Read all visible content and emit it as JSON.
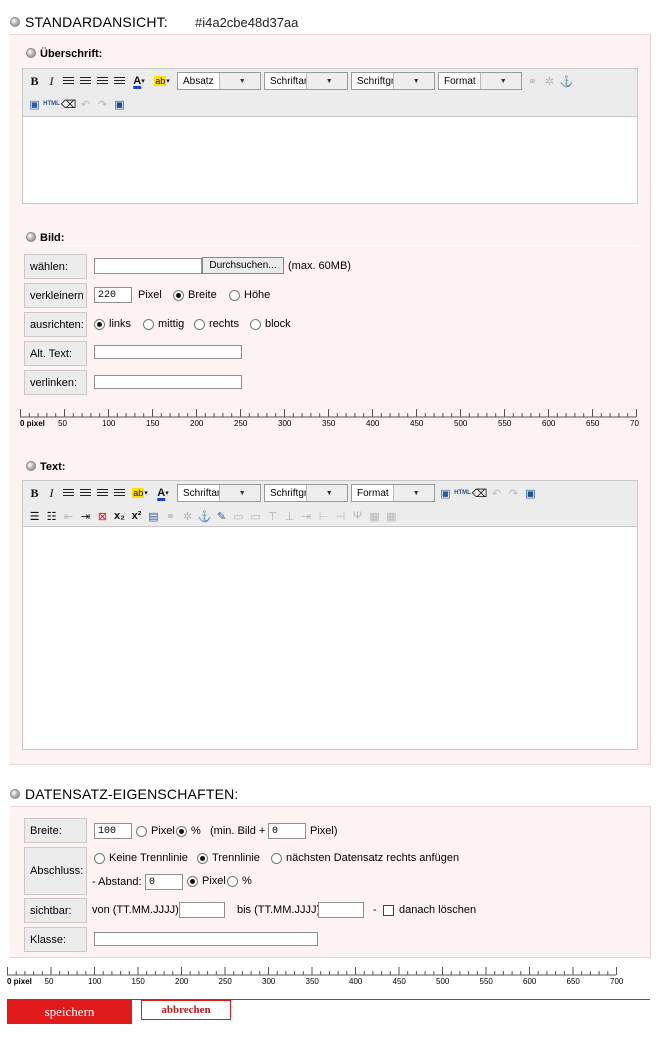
{
  "std": {
    "title": "STANDARDANSICHT:",
    "id": "#i4a2cbe48d37aa"
  },
  "heading": {
    "title": "Überschrift:"
  },
  "toolbar1": {
    "block": "Absatz",
    "font": "Schriftart",
    "size": "Schriftgröße",
    "format": "Format"
  },
  "image": {
    "title": "Bild:",
    "choose_label": "wählen:",
    "browse": "Durchsuchen...",
    "maxsize": "(max. 60MB)",
    "shrink_label": "verkleinern",
    "shrink_value": "220",
    "pixel": "Pixel",
    "width": "Breite",
    "height": "Höhe",
    "align_label": "ausrichten:",
    "left": "links",
    "center": "mittig",
    "right": "rechts",
    "block": "block",
    "alt_label": "Alt. Text:",
    "link_label": "verlinken:"
  },
  "ruler1": {
    "labels": [
      "0 pixel",
      "50",
      "100",
      "150",
      "200",
      "250",
      "300",
      "350",
      "400",
      "450",
      "500",
      "550",
      "600",
      "650",
      "70"
    ]
  },
  "text": {
    "title": "Text:"
  },
  "toolbar2": {
    "font": "Schriftart",
    "size": "Schriftgröße",
    "format": "Format"
  },
  "record": {
    "title": "DATENSATZ-EIGENSCHAFTEN:",
    "width_label": "Breite:",
    "width_value": "100",
    "pixel": "Pixel",
    "percent": "%",
    "min_text": "(min. Bild +",
    "min_value": "0",
    "min_unit": "Pixel)",
    "end_label": "Abschluss:",
    "no_line": "Keine Trennlinie",
    "line": "Trennlinie",
    "next_right": "nächsten Datensatz rechts anfügen",
    "spacing_label": "- Abstand:",
    "spacing_value": "0",
    "spacing_pixel": "Pixel",
    "spacing_percent": "%",
    "visible_label": "sichtbar:",
    "from": "von (TT.MM.JJJJ):",
    "to": "bis (TT.MM.JJJJ)",
    "dash": "-",
    "delete_after": "danach löschen",
    "class_label": "Klasse:"
  },
  "ruler2": {
    "labels": [
      "0 pixel",
      "50",
      "100",
      "150",
      "200",
      "250",
      "300",
      "350",
      "400",
      "450",
      "500",
      "550",
      "600",
      "650",
      "700"
    ]
  },
  "actions": {
    "save": "speichern",
    "cancel": "abbrechen"
  },
  "colors": {
    "accent": "#e01b1b",
    "pink": "#fdf3f3"
  }
}
